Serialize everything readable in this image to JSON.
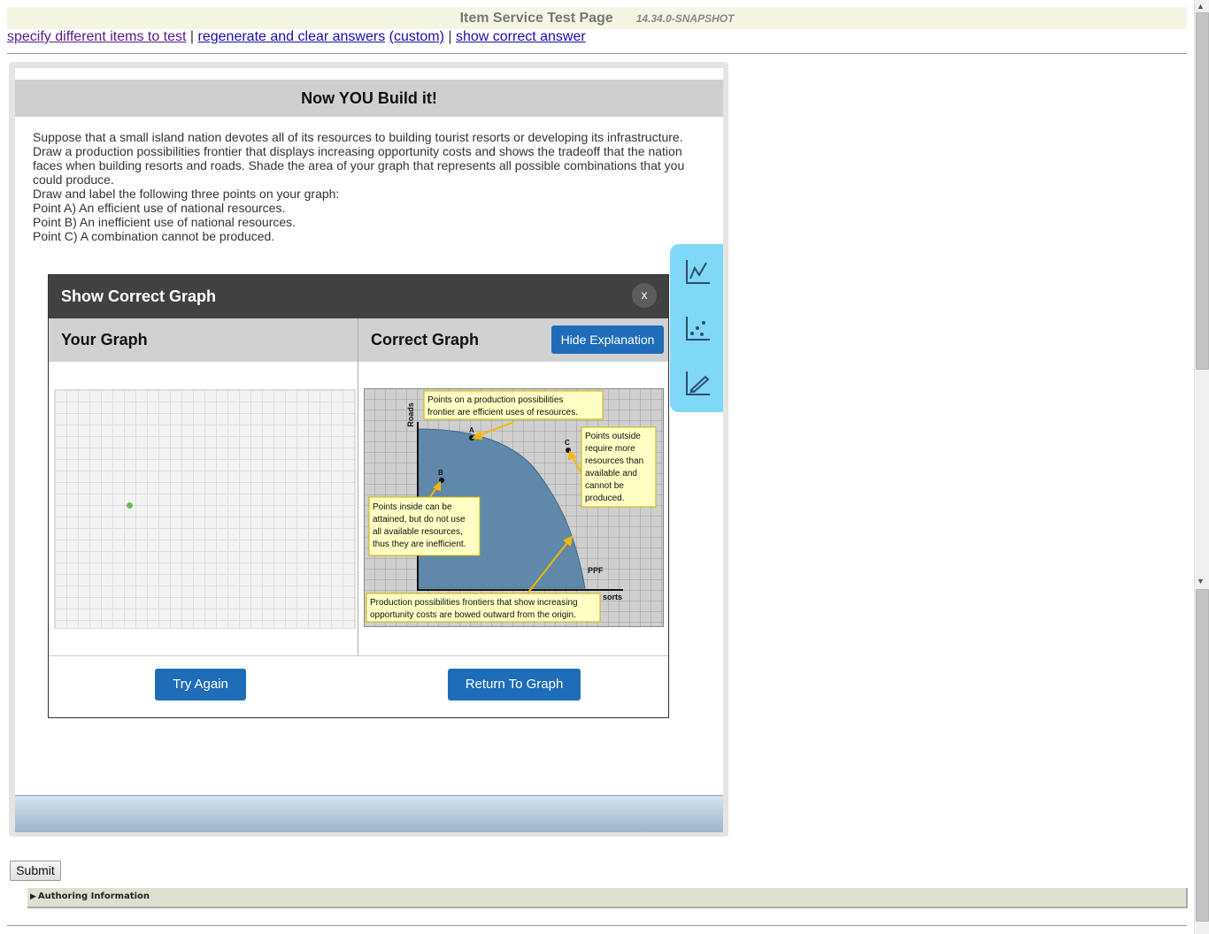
{
  "page": {
    "title": "Item Service Test Page",
    "version": "14.34.0-SNAPSHOT"
  },
  "links": {
    "specify": "specify different items to test",
    "sep1": "|",
    "regenerate": "regenerate and clear answers",
    "custom": "(custom)",
    "sep2": "|",
    "show_correct": "show correct answer"
  },
  "item": {
    "header": "Now YOU Build it!",
    "prompt_lines": [
      "Suppose that a small island nation devotes all of its resources to building tourist resorts or developing its infrastructure.",
      "Draw a production possibilities frontier that displays increasing opportunity costs and shows the tradeoff that the nation",
      "faces when building resorts and roads. Shade the area of your graph that represents all possible combinations that you",
      "could produce.",
      "Draw and label the following three points on your graph:",
      "Point A) An efficient use of national resources.",
      "Point B) An inefficient use of national resources.",
      "Point C) A combination cannot be produced."
    ]
  },
  "tools": [
    {
      "name": "line-tool-icon"
    },
    {
      "name": "point-tool-icon"
    },
    {
      "name": "draw-tool-icon"
    }
  ],
  "modal": {
    "title": "Show Correct Graph",
    "close_label": "x",
    "your_graph_label": "Your Graph",
    "correct_graph_label": "Correct Graph",
    "hide_explanation": "Hide Explanation",
    "try_again": "Try Again",
    "return_to_graph": "Return To Graph"
  },
  "correct_graph": {
    "y_axis": "Roads",
    "x_axis_partial": "sorts",
    "curve_label": "PPF",
    "points": [
      "A",
      "B",
      "C"
    ],
    "callouts": {
      "efficient": [
        "Points on a production possibilities",
        "frontier are efficient uses of resources."
      ],
      "outside": [
        "Points outside",
        "require more",
        "resources than",
        "available and",
        "cannot be",
        "produced."
      ],
      "inside": [
        "Points inside can be",
        "attained, but do not use",
        "all available resources,",
        "thus they are inefficient."
      ],
      "bowed": [
        "Production possibilities frontiers that show increasing",
        "opportunity costs are bowed outward from the origin."
      ]
    }
  },
  "submit_label": "Submit",
  "authoring": {
    "toggle": "▶",
    "label": "Authoring Information"
  },
  "colors": {
    "accent_button": "#1f6db8",
    "tool_palette": "#7fd8f6",
    "modal_header": "#414141",
    "ppf_fill": "#5f88aa",
    "callout_bg": "#ffffc4",
    "arrow": "#f5b800"
  }
}
